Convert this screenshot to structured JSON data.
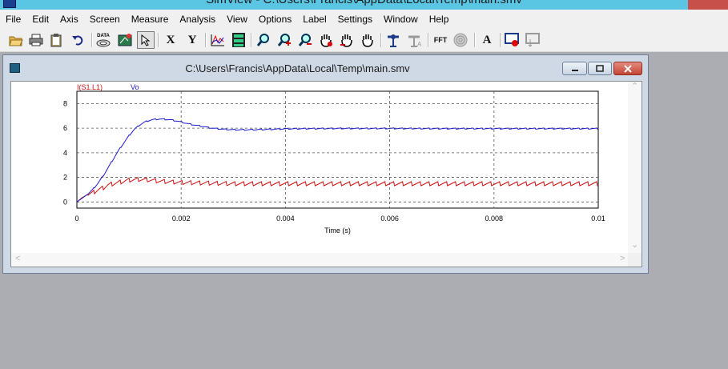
{
  "app": {
    "title": "SimView - C:\\Users\\Francis\\AppData\\Local\\Temp\\main.smv"
  },
  "menu": [
    "File",
    "Edit",
    "Axis",
    "Screen",
    "Measure",
    "Analysis",
    "View",
    "Options",
    "Label",
    "Settings",
    "Window",
    "Help"
  ],
  "toolbar": {
    "data_label": "DATA",
    "x_label": "X",
    "y_label": "Y",
    "fft_label": "FFT",
    "text_label": "A",
    "icons": [
      "open-icon",
      "print-icon",
      "clipboard-icon",
      "undo-icon",
      "data-icon",
      "screen-setup-icon",
      "select-arrow-icon",
      "x-axis-icon",
      "y-axis-icon",
      "chart-icon",
      "layout-icon",
      "zoom-icon",
      "zoom-in-icon",
      "zoom-out-icon",
      "pan-icon",
      "pan-x-icon",
      "pan-y-icon",
      "marker-icon",
      "text-marker-icon",
      "fft-icon",
      "spectrum-icon",
      "text-icon",
      "record-icon",
      "graph-icon"
    ]
  },
  "document": {
    "title": "C:\\Users\\Francis\\AppData\\Local\\Temp\\main.smv"
  },
  "colors": {
    "series_i": "#cc1010",
    "series_vo": "#1a1acc",
    "grid": "#555555",
    "axis": "#000000"
  },
  "chart_data": {
    "type": "line",
    "title": "",
    "xlabel": "Time (s)",
    "ylabel": "",
    "xlim": [
      0,
      0.01
    ],
    "ylim": [
      -0.5,
      9
    ],
    "x_ticks": [
      "0",
      "0.002",
      "0.004",
      "0.006",
      "0.008",
      "0.01"
    ],
    "y_ticks": [
      "0",
      "2",
      "4",
      "6",
      "8"
    ],
    "grid": true,
    "legend": "top-left",
    "series": [
      {
        "name": "I(S1.L1)",
        "x": [
          0,
          0.0001,
          0.0002,
          0.0003,
          0.0004,
          0.0005,
          0.0006,
          0.0007,
          0.0008,
          0.0009,
          0.001,
          0.0012,
          0.0014,
          0.0016,
          0.0018,
          0.002,
          0.0025,
          0.003,
          0.004,
          0.005,
          0.006,
          0.007,
          0.008,
          0.009,
          0.01
        ],
        "values": [
          0,
          0.35,
          0.6,
          0.75,
          1.0,
          1.15,
          1.4,
          1.5,
          1.6,
          1.7,
          1.8,
          1.85,
          1.8,
          1.7,
          1.65,
          1.6,
          1.55,
          1.5,
          1.5,
          1.5,
          1.5,
          1.5,
          1.5,
          1.5,
          1.5
        ],
        "ripple": 0.18
      },
      {
        "name": "Vo",
        "x": [
          0,
          0.0001,
          0.0002,
          0.0003,
          0.0004,
          0.0005,
          0.0006,
          0.0007,
          0.0008,
          0.0009,
          0.001,
          0.0011,
          0.0012,
          0.0013,
          0.0014,
          0.0015,
          0.0016,
          0.0017,
          0.0018,
          0.0019,
          0.002,
          0.0022,
          0.0024,
          0.0026,
          0.0028,
          0.003,
          0.0032,
          0.0034,
          0.0036,
          0.0038,
          0.004,
          0.0045,
          0.005,
          0.006,
          0.007,
          0.008,
          0.009,
          0.01
        ],
        "values": [
          0,
          0.3,
          0.6,
          1.0,
          1.5,
          2.1,
          2.8,
          3.5,
          4.2,
          4.8,
          5.4,
          5.9,
          6.25,
          6.5,
          6.65,
          6.72,
          6.75,
          6.72,
          6.68,
          6.6,
          6.5,
          6.3,
          6.15,
          6.0,
          5.92,
          5.88,
          5.87,
          5.88,
          5.9,
          5.92,
          5.95,
          5.97,
          5.98,
          5.98,
          5.97,
          5.97,
          5.97,
          5.97
        ],
        "ripple": 0.05
      }
    ]
  }
}
